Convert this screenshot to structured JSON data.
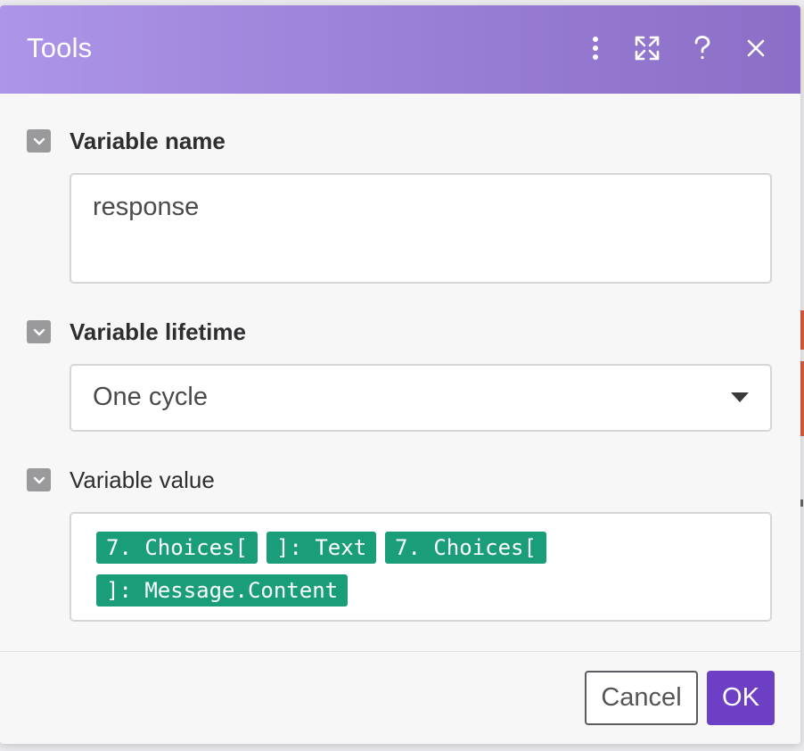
{
  "dialog": {
    "title": "Tools",
    "header_icons": [
      "more-vertical-icon",
      "expand-icon",
      "help-icon",
      "close-icon"
    ]
  },
  "fields": {
    "variable_name": {
      "label": "Variable name",
      "value": "response"
    },
    "variable_lifetime": {
      "label": "Variable lifetime",
      "value": "One cycle"
    },
    "variable_value": {
      "label": "Variable value",
      "tokens": [
        "7. Choices[",
        "]: Text",
        "7. Choices[",
        "]: Message.Content"
      ]
    }
  },
  "footer": {
    "cancel_label": "Cancel",
    "ok_label": "OK"
  },
  "colors": {
    "header_gradient_start": "#ad95e8",
    "header_gradient_end": "#8c6ec7",
    "token_bg": "#1a9e79",
    "ok_button": "#6d3fc5"
  }
}
